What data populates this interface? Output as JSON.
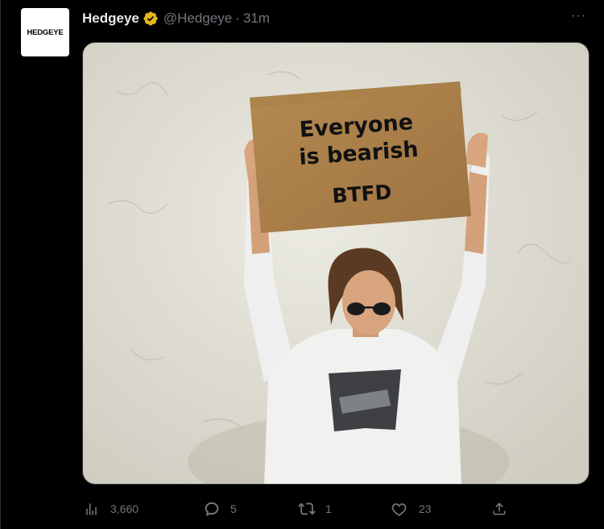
{
  "tweet": {
    "avatar_text": "HEDGEYE",
    "display_name": "Hedgeye",
    "handle": "@Hedgeye",
    "separator": "·",
    "time": "31m",
    "more_label": "···",
    "media": {
      "sign_lines": [
        "Everyone",
        "is bearish",
        "BTFD"
      ]
    },
    "actions": {
      "views": "3,660",
      "replies": "5",
      "retweets": "1",
      "likes": "23"
    }
  },
  "colors": {
    "background": "#000000",
    "primary_text": "#e7e9ea",
    "secondary_text": "#71767b",
    "verified_badge": "#e2b719",
    "border": "#2f3336"
  },
  "icons": [
    "verified-icon",
    "more-icon",
    "views-icon",
    "reply-icon",
    "retweet-icon",
    "like-icon",
    "share-icon"
  ]
}
